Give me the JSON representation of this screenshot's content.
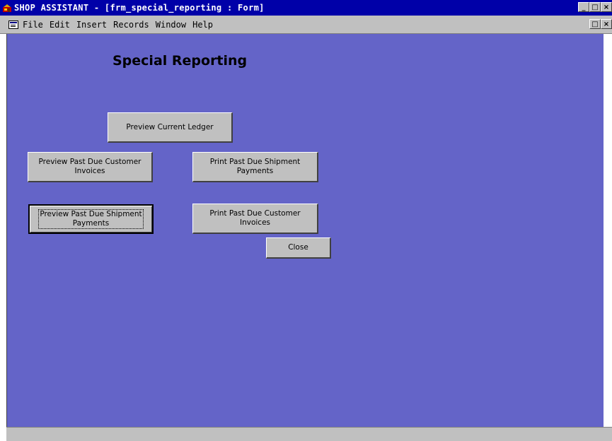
{
  "window": {
    "title": "SHOP ASSISTANT - [frm_special_reporting : Form]",
    "controls": [
      "_",
      "□",
      "×"
    ]
  },
  "menubar": {
    "items": [
      {
        "label": "File"
      },
      {
        "label": "Edit"
      },
      {
        "label": "Insert"
      },
      {
        "label": "Records"
      },
      {
        "label": "Window"
      },
      {
        "label": "Help"
      }
    ]
  },
  "form": {
    "heading": "Special Reporting",
    "buttons": {
      "preview_current_ledger": "Preview Current Ledger",
      "preview_past_due_customer_invoices": "Preview Past Due Customer\nInvoices",
      "print_past_due_shipment_payments": "Print Past Due Shipment\nPayments",
      "preview_past_due_shipment_payments": "Preview Past Due Shipment\nPayments",
      "print_past_due_customer_invoices": "Print Past Due Customer\nInvoices",
      "close": "Close"
    }
  },
  "colors": {
    "titlebar": "#0000a8",
    "form_background": "#6464c8",
    "button_face": "#c0c0c0"
  }
}
